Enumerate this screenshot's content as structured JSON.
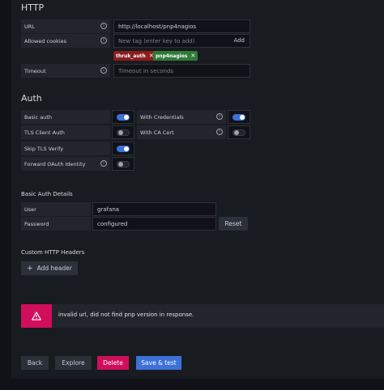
{
  "http": {
    "title": "HTTP",
    "url_label": "URL",
    "url_value": "http://localhost/pnp4nagios",
    "cookies_label": "Allowed cookies",
    "cookies_placeholder": "New tag (enter key to add)",
    "cookies_add": "Add",
    "tags": [
      {
        "label": "thruk_auth",
        "color": "#8b1d1d"
      },
      {
        "label": "pnp4nagios",
        "color": "#2f7a38"
      }
    ],
    "timeout_label": "Timeout",
    "timeout_placeholder": "Timeout in seconds",
    "info_glyph": "i"
  },
  "auth": {
    "title": "Auth",
    "basic_auth": "Basic auth",
    "with_credentials": "With Credentials",
    "tls_client_auth": "TLS Client Auth",
    "with_ca_cert": "With CA Cert",
    "skip_tls_verify": "Skip TLS Verify",
    "forward_oauth": "Forward OAuth Identity",
    "toggles": {
      "basic_auth": true,
      "with_credentials": true,
      "tls_client_auth": false,
      "with_ca_cert": false,
      "skip_tls_verify": true,
      "forward_oauth": false
    }
  },
  "basic_auth_details": {
    "title": "Basic Auth Details",
    "user_label": "User",
    "user_value": "grafana",
    "password_label": "Password",
    "password_value": "configured",
    "reset": "Reset"
  },
  "custom_headers": {
    "title": "Custom HTTP Headers",
    "add_header": "Add header"
  },
  "alert": {
    "message": "invalid url, did not find pnp version in response.",
    "icon": "warning-triangle-icon"
  },
  "actions": {
    "back": "Back",
    "explore": "Explore",
    "delete": "Delete",
    "save_test": "Save & test"
  },
  "colors": {
    "primary": "#3d71d9",
    "destructive": "#d10e5c"
  }
}
